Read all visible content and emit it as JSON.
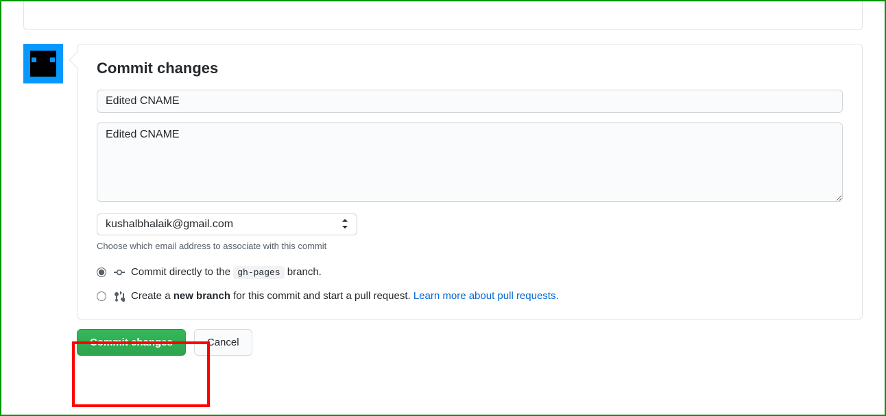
{
  "heading": "Commit changes",
  "summary_value": "Edited CNAME",
  "description_value": "Edited CNAME",
  "email_selected": "kushalbhalaik@gmail.com",
  "email_help": "Choose which email address to associate with this commit",
  "radio_direct": {
    "prefix": "Commit directly to the ",
    "branch": "gh-pages",
    "suffix": " branch."
  },
  "radio_newbranch": {
    "prefix": "Create a ",
    "bold": "new branch",
    "mid": " for this commit and start a pull request. ",
    "link": "Learn more about pull requests."
  },
  "buttons": {
    "commit": "Commit changes",
    "cancel": "Cancel"
  }
}
